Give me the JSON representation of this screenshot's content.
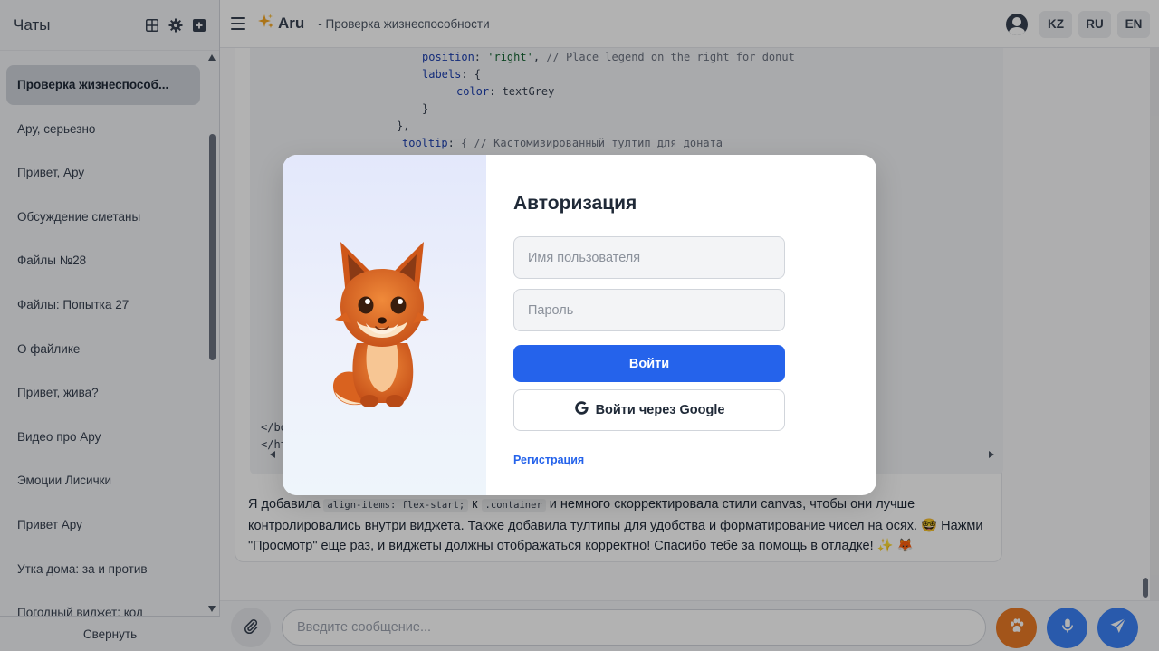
{
  "sidebar": {
    "title": "Чаты",
    "collapse_label": "Свернуть",
    "items": [
      {
        "label": "Проверка жизнеспособ..."
      },
      {
        "label": "Ару, серьезно"
      },
      {
        "label": "Привет, Ару"
      },
      {
        "label": "Обсуждение сметаны"
      },
      {
        "label": "Файлы №28"
      },
      {
        "label": "Файлы: Попытка 27"
      },
      {
        "label": "О файлике"
      },
      {
        "label": "Привет, жива?"
      },
      {
        "label": "Видео про Ару"
      },
      {
        "label": "Эмоции Лисички"
      },
      {
        "label": "Привет Ару"
      },
      {
        "label": "Утка дома: за и против"
      },
      {
        "label": "Погодный виджет: код"
      }
    ]
  },
  "header": {
    "brand": "Aru",
    "brand_icon": "sparkles-icon",
    "breadcrumb": "- Проверка жизнеспособности",
    "languages": [
      "KZ",
      "RU",
      "EN"
    ]
  },
  "code": {
    "line1_key": "position",
    "line1_val": "'right'",
    "line1_comment": "// Place legend on the right for donut",
    "line2_key": "labels",
    "line3_key": "color",
    "line3_val": "textGrey",
    "line4": "}",
    "line5": "},",
    "line6_key": "tooltip",
    "line6_comment": "{ // Кастомизированный тултип для доната",
    "line7": "</bo",
    "line8": "</ht"
  },
  "message": {
    "part1": "Я добавила",
    "code1": "align-items: flex-start;",
    "part2": "к",
    "code2": ".container",
    "part3": "и немного скорректировала стили canvas, чтобы они лучше контролировались внутри виджета. Также добавила тултипы для удобства и форматирование чисел на осях. 🤓 Нажми \"Просмотр\" еще раз, и виджеты должны отображаться корректно! Спасибо тебе за помощь в отладке! ✨ 🦊"
  },
  "input": {
    "placeholder": "Введите сообщение..."
  },
  "modal": {
    "title": "Авторизация",
    "username_placeholder": "Имя пользователя",
    "password_placeholder": "Пароль",
    "login_label": "Войти",
    "google_label": "Войти через Google",
    "register_label": "Регистрация"
  },
  "colors": {
    "primary": "#2563eb",
    "accent_orange": "#ea7a26",
    "button_blue": "#3b82f6"
  }
}
